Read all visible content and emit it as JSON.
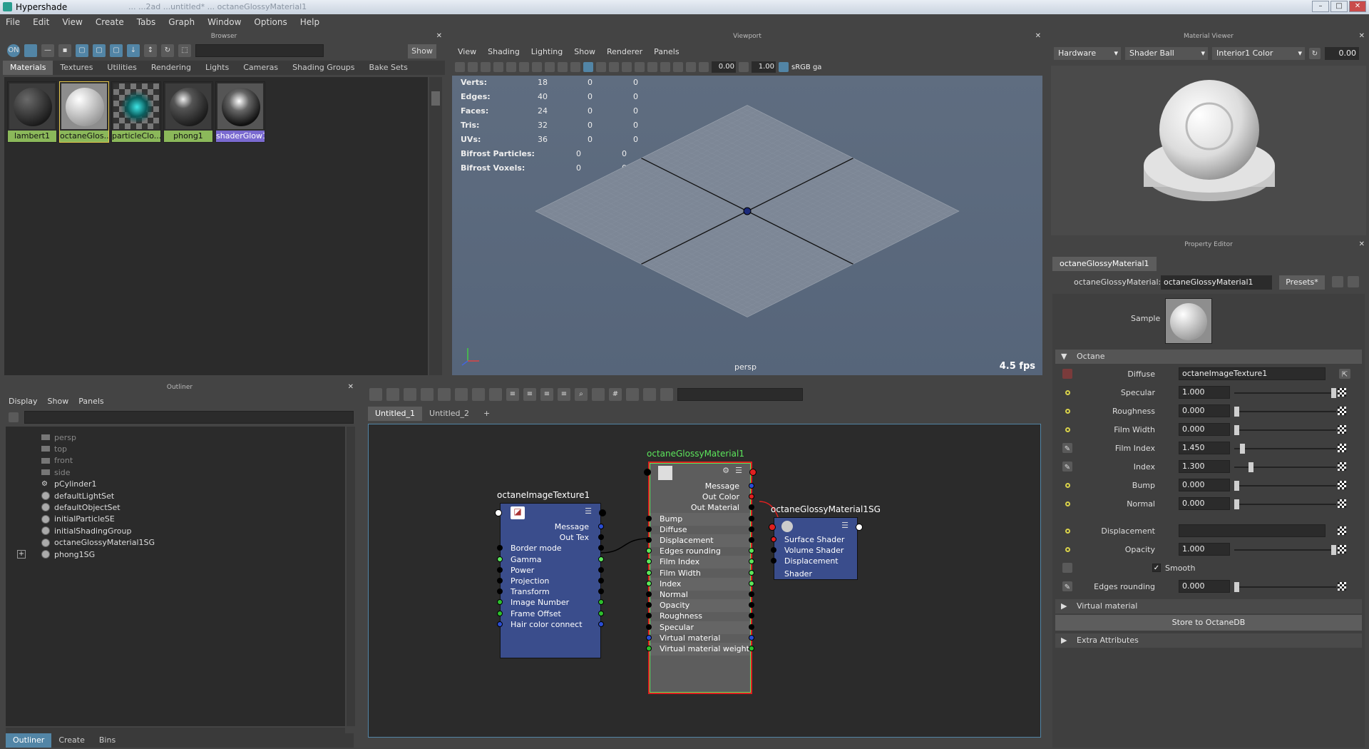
{
  "window": {
    "title": "Hypershade",
    "title_suffix": "... ...2ad ...untitled* ... octaneGlossyMaterial1"
  },
  "menu": [
    "File",
    "Edit",
    "View",
    "Create",
    "Tabs",
    "Graph",
    "Window",
    "Options",
    "Help"
  ],
  "browser": {
    "title": "Browser",
    "show_btn": "Show",
    "tabs": [
      "Materials",
      "Textures",
      "Utilities",
      "Rendering",
      "Lights",
      "Cameras",
      "Shading Groups",
      "Bake Sets"
    ],
    "items": [
      {
        "label": "lambert1"
      },
      {
        "label": "octaneGlos..."
      },
      {
        "label": "particleClo..."
      },
      {
        "label": "phong1"
      },
      {
        "label": "shaderGlow1"
      }
    ]
  },
  "viewport": {
    "title": "Viewport",
    "menu": [
      "View",
      "Shading",
      "Lighting",
      "Show",
      "Renderer",
      "Panels"
    ],
    "num1": "0.00",
    "num2": "1.00",
    "colorspace": "sRGB ga",
    "stats": [
      {
        "label": "Verts:",
        "v": [
          "18",
          "0",
          "0"
        ]
      },
      {
        "label": "Edges:",
        "v": [
          "40",
          "0",
          "0"
        ]
      },
      {
        "label": "Faces:",
        "v": [
          "24",
          "0",
          "0"
        ]
      },
      {
        "label": "Tris:",
        "v": [
          "32",
          "0",
          "0"
        ]
      },
      {
        "label": "UVs:",
        "v": [
          "36",
          "0",
          "0"
        ]
      },
      {
        "label": "Bifrost Particles:",
        "v": [
          "0",
          "0"
        ]
      },
      {
        "label": "Bifrost Voxels:",
        "v": [
          "0",
          "0"
        ]
      }
    ],
    "camera": "persp",
    "fps": "4.5 fps"
  },
  "material_viewer": {
    "title": "Material Viewer",
    "renderer": "Hardware",
    "geometry": "Shader Ball",
    "environment": "Interior1 Color",
    "value": "0.00"
  },
  "outliner": {
    "title": "Outliner",
    "menu": [
      "Display",
      "Show",
      "Panels"
    ],
    "items": [
      "persp",
      "top",
      "front",
      "side",
      "pCylinder1",
      "defaultLightSet",
      "defaultObjectSet",
      "initialParticleSE",
      "initialShadingGroup",
      "octaneGlossyMaterial1SG",
      "phong1SG"
    ],
    "tabs": [
      "Outliner",
      "Create",
      "Bins"
    ]
  },
  "graph": {
    "tabs": [
      "Untitled_1",
      "Untitled_2",
      "+"
    ],
    "nodes": {
      "tex": {
        "name": "octaneImageTexture1",
        "outputs": [
          "Message",
          "Out Tex"
        ],
        "inputs": [
          "Border mode",
          "Gamma",
          "Power",
          "Projection",
          "Transform",
          "Image Number",
          "Frame Offset",
          "Hair color connect"
        ]
      },
      "mat": {
        "name": "octaneGlossyMaterial1",
        "outputs": [
          "Message",
          "Out Color",
          "Out Material"
        ],
        "inputs": [
          "Bump",
          "Diffuse",
          "Displacement",
          "Edges rounding",
          "Film Index",
          "Film Width",
          "Index",
          "Normal",
          "Opacity",
          "Roughness",
          "Specular",
          "Virtual material",
          "Virtual material weight"
        ]
      },
      "sg": {
        "name": "octaneGlossyMaterial1SG",
        "inputs": [
          "Surface Shader",
          "Volume Shader",
          "Displacement Shader"
        ]
      }
    }
  },
  "property_editor": {
    "title": "Property Editor",
    "tab": "octaneGlossyMaterial1",
    "type_label": "octaneGlossyMaterial:",
    "name_value": "octaneGlossyMaterial1",
    "presets": "Presets*",
    "sample": "Sample",
    "section": "Octane",
    "diffuse_label": "Diffuse",
    "diffuse_value": "octaneImageTexture1",
    "rows": [
      {
        "label": "Specular",
        "value": "1.000",
        "pos": 1.0
      },
      {
        "label": "Roughness",
        "value": "0.000",
        "pos": 0.0
      },
      {
        "label": "Film Width",
        "value": "0.000",
        "pos": 0.0
      },
      {
        "label": "Film Index",
        "value": "1.450",
        "pos": 0.06
      },
      {
        "label": "Index",
        "value": "1.300",
        "pos": 0.15
      },
      {
        "label": "Bump",
        "value": "0.000",
        "pos": 0.0
      },
      {
        "label": "Normal",
        "value": "0.000",
        "pos": 0.0
      }
    ],
    "displacement_label": "Displacement",
    "opacity_label": "Opacity",
    "opacity_value": "1.000",
    "opacity_pos": 1.0,
    "smooth_label": "Smooth",
    "edges_label": "Edges rounding",
    "edges_value": "0.000",
    "virtual_material": "Virtual material",
    "store_btn": "Store to OctaneDB",
    "extra": "Extra Attributes"
  }
}
